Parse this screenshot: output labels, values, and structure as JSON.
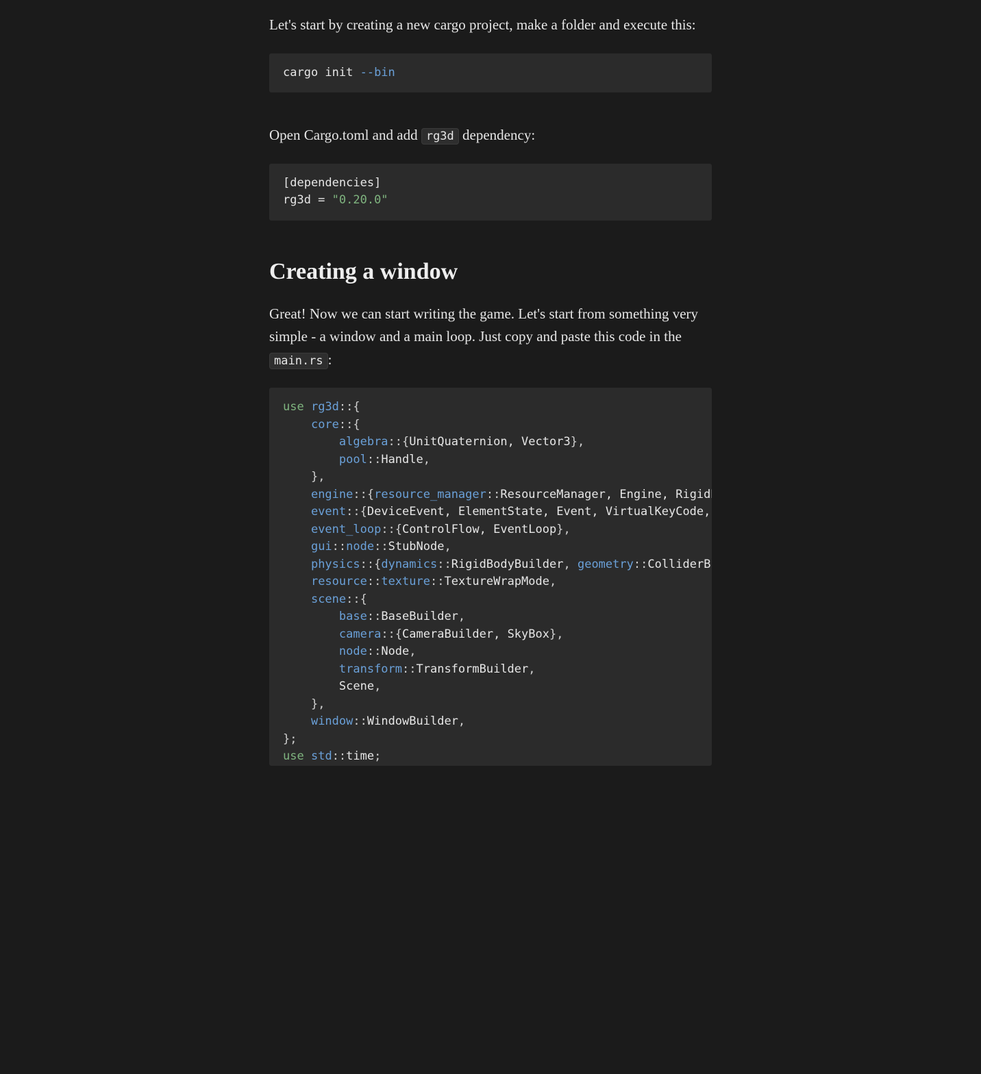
{
  "intro_p1": "Let's start by creating a new cargo project, make a folder and execute this:",
  "code1": {
    "cmd": "cargo init ",
    "flag": "--bin"
  },
  "intro_p2_a": "Open Cargo.toml and add ",
  "intro_p2_code": "rg3d",
  "intro_p2_b": " dependency:",
  "code2": {
    "l1": "[dependencies]",
    "l2a": "rg3d = ",
    "l2b": "\"0.20.0\""
  },
  "heading": "Creating a window",
  "window_p_a": "Great! Now we can start writing the game. Let's start from something very simple - a window and a main loop. Just copy and paste this code in the ",
  "window_p_code": "main.rs",
  "window_p_b": ":",
  "code3": {
    "use1": "use",
    "rg3d": "rg3d",
    "cc": "::",
    "ob": "{",
    "cb": "}",
    "core": "core",
    "algebra": "algebra",
    "algebra_items": "UnitQuaternion, Vector3",
    "pool": "pool",
    "pool_items": "Handle",
    "engine": "engine",
    "resource_manager": "resource_manager",
    "engine_items": "ResourceManager, Engine, RigidBo",
    "event": "event",
    "event_items": "DeviceEvent, ElementState, Event, VirtualKeyCode, W",
    "event_loop": "event_loop",
    "event_loop_items": "ControlFlow, EventLoop",
    "gui": "gui",
    "guinode": "node",
    "gui_items": "StubNode",
    "physics": "physics",
    "dynamics": "dynamics",
    "dynamics_items": "RigidBodyBuilder",
    "geometry": "geometry",
    "geometry_items": "ColliderBui",
    "resource": "resource",
    "texture": "texture",
    "texture_items": "TextureWrapMode",
    "scene": "scene",
    "base": "base",
    "base_items": "BaseBuilder",
    "camera": "camera",
    "camera_items": "CameraBuilder, SkyBox",
    "snode": "node",
    "snode_items": "Node",
    "transform": "transform",
    "transform_items": "TransformBuilder",
    "scene_lit": "Scene",
    "window": "window",
    "window_items": "WindowBuilder",
    "use2": "use",
    "std": "std",
    "time": "time"
  }
}
